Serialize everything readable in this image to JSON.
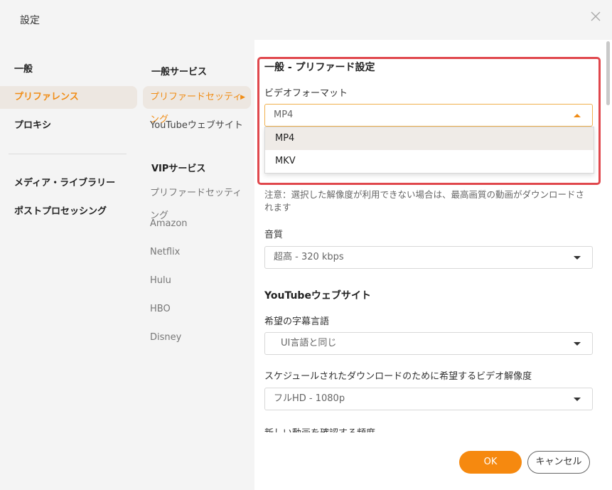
{
  "window": {
    "title": "設定"
  },
  "nav1": {
    "items": [
      {
        "label": "一般"
      },
      {
        "label": "プリファレンス"
      },
      {
        "label": "プロキシ"
      },
      {
        "label": "メディア・ライブラリー"
      },
      {
        "label": "ポストプロセッシング"
      }
    ]
  },
  "nav2": {
    "section1": "一般サービス",
    "section2": "VIPサービス",
    "items": [
      {
        "label": "プリファードセッティング"
      },
      {
        "label": "YouTubeウェブサイト"
      },
      {
        "label": "プリファードセッティング"
      },
      {
        "label": "Amazon"
      },
      {
        "label": "Netflix"
      },
      {
        "label": "Hulu"
      },
      {
        "label": "HBO"
      },
      {
        "label": "Disney"
      }
    ]
  },
  "main": {
    "section_general": "一般 - プリファード設定",
    "video_format_label": "ビデオフォーマット",
    "video_format_value": "MP4",
    "video_format_options": [
      "MP4",
      "MKV"
    ],
    "note": "注意：選択した解像度が利用できない場合は、最高画質の動画がダウンロードされます",
    "audio_label": "音質",
    "audio_value": "超高 - 320 kbps",
    "section_youtube": "YouTubeウェブサイト",
    "subtitle_label": "希望の字幕言語",
    "subtitle_value": "UI言語と同じ",
    "resolution_label": "スケジュールされたダウンロードのために希望するビデオ解像度",
    "resolution_value": "フルHD - 1080p",
    "check_label": "新しい動画を確認する頻度"
  },
  "footer": {
    "ok": "OK",
    "cancel": "キャンセル"
  },
  "colors": {
    "accent": "#f6890f",
    "highlight": "#e0474c"
  }
}
